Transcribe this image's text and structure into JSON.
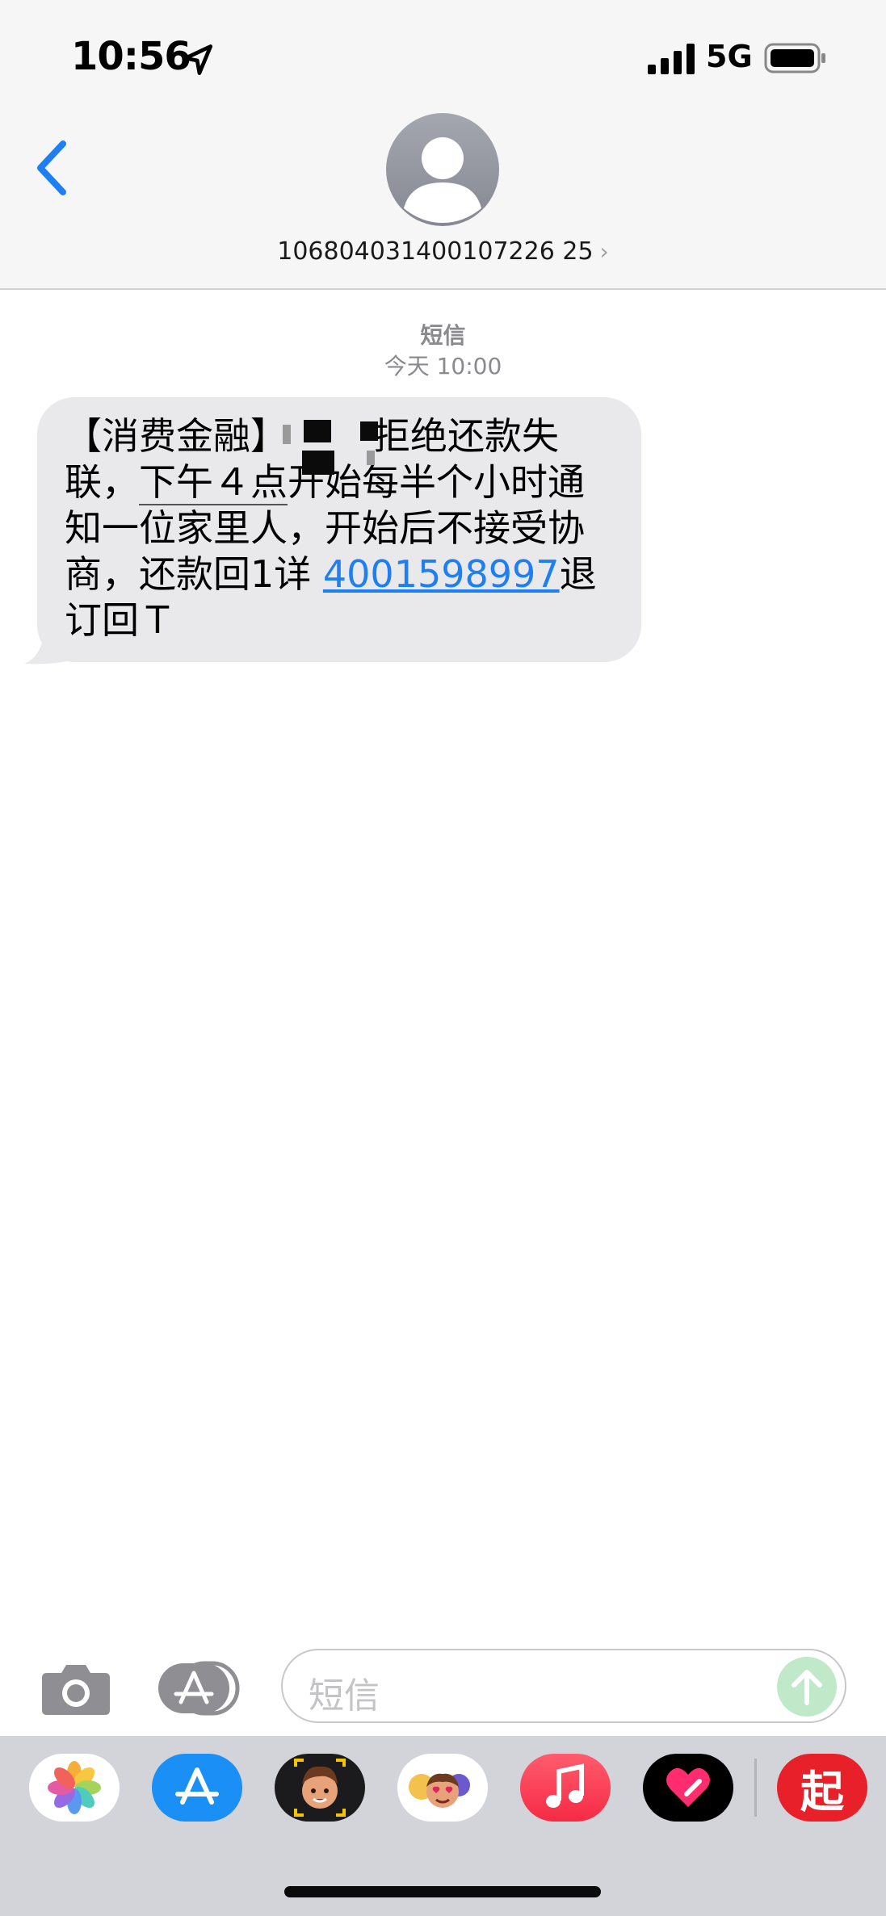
{
  "status_bar": {
    "time": "10:56",
    "network": "5G"
  },
  "header": {
    "sender_number": "106804031400107226 25",
    "chevron": "›"
  },
  "thread": {
    "service_label": "短信",
    "timestamp": "今天 10:00",
    "message": {
      "line1": "【消费金融】",
      "line1_tail": "拒绝还款失",
      "line2_a": "联，",
      "line2_b": "下午４点",
      "line2_c": "开始每半个小时通",
      "line3": "知一位家里人，开始后不接受协",
      "line4_a": "商，还款回1详 ",
      "line4_link": "4001598997",
      "line4_b": "退",
      "line5": "订回Ｔ"
    }
  },
  "compose": {
    "placeholder": "短信"
  },
  "drawer": {
    "apps": [
      "photos",
      "app-store",
      "memoji-stickers",
      "animoji",
      "music",
      "fitness-heart",
      "qi-app"
    ],
    "qi_label": "起"
  },
  "colors": {
    "link": "#1d7ff3",
    "bubble": "#e9e9eb",
    "accent_blue": "#1d7ff3"
  }
}
